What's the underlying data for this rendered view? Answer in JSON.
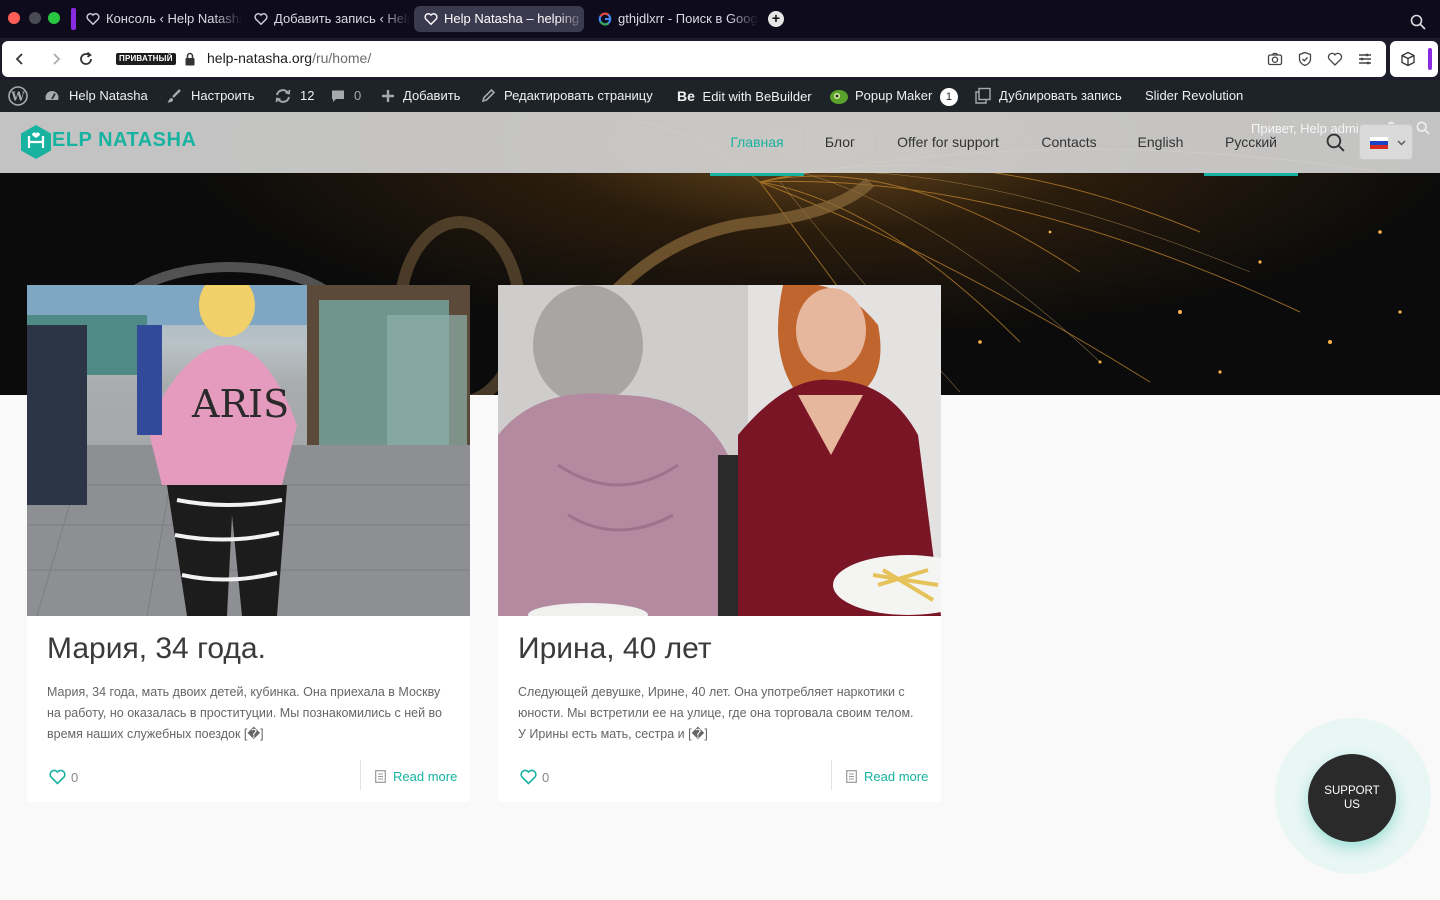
{
  "browser": {
    "tabs": [
      {
        "title": "Консоль ‹ Help Natasha",
        "active": false
      },
      {
        "title": "Добавить запись ‹ Help Natasha",
        "active": false
      },
      {
        "title": "Help Natasha – helping",
        "active": true
      },
      {
        "title": "gthjdlxrr - Поиск в Google",
        "active": false
      }
    ],
    "new_tab_label": "+",
    "private_badge": "ПРИВАТНЫЙ",
    "url_host": "help-natasha.org",
    "url_path": "/ru/home/"
  },
  "adminbar": {
    "site_name": "Help Natasha",
    "customize": "Настроить",
    "updates_count": "12",
    "comments_count": "0",
    "add_new": "Добавить",
    "edit_page": "Редактировать страницу",
    "bebuilder": "Edit with BeBuilder",
    "bebuilder_logo": "Be",
    "popup_maker": "Popup Maker",
    "popup_count": "1",
    "duplicate": "Дублировать запись",
    "slider_revolution": "Slider Revolution"
  },
  "site": {
    "logo_text": "ELP NATASHA",
    "greeting": "Привет, Help admin",
    "menu": [
      {
        "label": "Главная",
        "active": true
      },
      {
        "label": "Блог",
        "active": false
      },
      {
        "label": "Offer for support",
        "active": false
      },
      {
        "label": "Contacts",
        "active": false
      },
      {
        "label": "English",
        "active": false
      },
      {
        "label": "Русский",
        "active": true
      }
    ],
    "posts": [
      {
        "title": "Мария, 34 года.",
        "excerpt": "Мария, 34 года, мать двоих детей, кубинка. Она приехала в Москву на работу, но оказалась в проституции. Мы познакомились с ней во время наших служебных поездок [�]",
        "likes": "0",
        "read_more": "Read more"
      },
      {
        "title": "Ирина, 40 лет",
        "excerpt": "Следующей девушке, Ирине, 40 лет. Она употребляет наркотики с юности. Мы встретили ее на улице, где она торговала своим телом.  У Ирины есть мать, сестра и [�]",
        "likes": "0",
        "read_more": "Read more"
      }
    ],
    "support_button": "SUPPORT US"
  },
  "colors": {
    "accent": "#17b3a0",
    "adminbar_bg": "#1d2327",
    "tabbar_bg": "#0e0c1c",
    "support_bg": "#2b2a2a"
  }
}
